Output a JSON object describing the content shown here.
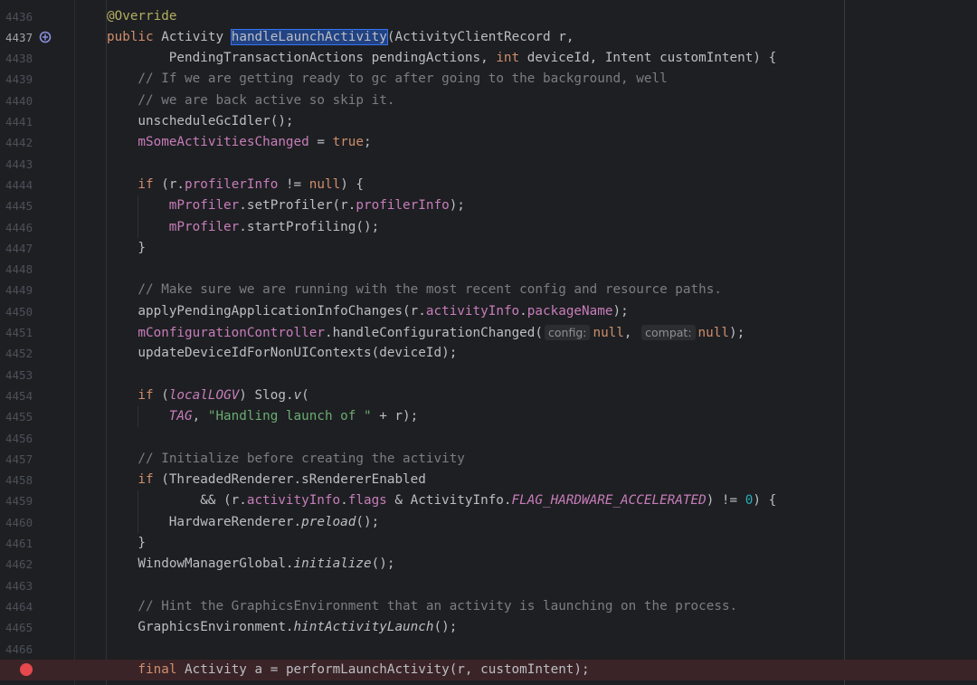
{
  "editor": {
    "lines": [
      {
        "n": "4436",
        "indent": 0,
        "tokens": [
          {
            "t": "@Override",
            "c": "ann"
          }
        ]
      },
      {
        "n": "4437",
        "indent": 0,
        "current": true,
        "icon": "override",
        "tokens": [
          {
            "t": "public ",
            "c": "kw"
          },
          {
            "t": "Activity ",
            "c": ""
          },
          {
            "t": "handleLaunchActivity",
            "c": "sel"
          },
          {
            "t": "(ActivityClientRecord r,",
            "c": ""
          }
        ]
      },
      {
        "n": "4438",
        "indent": 8,
        "tokens": [
          {
            "t": "PendingTransactionActions pendingActions, ",
            "c": ""
          },
          {
            "t": "int",
            "c": "kw"
          },
          {
            "t": " deviceId, Intent customIntent) {",
            "c": ""
          }
        ]
      },
      {
        "n": "4439",
        "indent": 4,
        "tokens": [
          {
            "t": "// If we are getting ready to gc after going to the background, well",
            "c": "cmt"
          }
        ]
      },
      {
        "n": "4440",
        "indent": 4,
        "tokens": [
          {
            "t": "// we are back active so skip it.",
            "c": "cmt"
          }
        ]
      },
      {
        "n": "4441",
        "indent": 4,
        "tokens": [
          {
            "t": "unscheduleGcIdler();",
            "c": ""
          }
        ]
      },
      {
        "n": "4442",
        "indent": 4,
        "tokens": [
          {
            "t": "mSomeActivitiesChanged",
            "c": "fld"
          },
          {
            "t": " = ",
            "c": ""
          },
          {
            "t": "true",
            "c": "kw"
          },
          {
            "t": ";",
            "c": ""
          }
        ]
      },
      {
        "n": "4443",
        "indent": 0,
        "tokens": []
      },
      {
        "n": "4444",
        "indent": 4,
        "tokens": [
          {
            "t": "if",
            "c": "kw"
          },
          {
            "t": " (r.",
            "c": ""
          },
          {
            "t": "profilerInfo",
            "c": "fld"
          },
          {
            "t": " != ",
            "c": ""
          },
          {
            "t": "null",
            "c": "kw"
          },
          {
            "t": ") {",
            "c": ""
          }
        ]
      },
      {
        "n": "4445",
        "indent": 8,
        "tokens": [
          {
            "t": "mProfiler",
            "c": "fld"
          },
          {
            "t": ".setProfiler(r.",
            "c": ""
          },
          {
            "t": "profilerInfo",
            "c": "fld"
          },
          {
            "t": ");",
            "c": ""
          }
        ]
      },
      {
        "n": "4446",
        "indent": 8,
        "tokens": [
          {
            "t": "mProfiler",
            "c": "fld"
          },
          {
            "t": ".startProfiling();",
            "c": ""
          }
        ]
      },
      {
        "n": "4447",
        "indent": 4,
        "tokens": [
          {
            "t": "}",
            "c": ""
          }
        ]
      },
      {
        "n": "4448",
        "indent": 0,
        "tokens": []
      },
      {
        "n": "4449",
        "indent": 4,
        "tokens": [
          {
            "t": "// Make sure we are running with the most recent config and resource paths.",
            "c": "cmt"
          }
        ]
      },
      {
        "n": "4450",
        "indent": 4,
        "tokens": [
          {
            "t": "applyPendingApplicationInfoChanges(r.",
            "c": ""
          },
          {
            "t": "activityInfo",
            "c": "fld"
          },
          {
            "t": ".",
            "c": ""
          },
          {
            "t": "packageName",
            "c": "fld"
          },
          {
            "t": ");",
            "c": ""
          }
        ]
      },
      {
        "n": "4451",
        "indent": 4,
        "tokens": [
          {
            "t": "mConfigurationController",
            "c": "fld"
          },
          {
            "t": ".handleConfigurationChanged(",
            "c": ""
          },
          {
            "t": "config:",
            "c": "hint"
          },
          {
            "t": "null",
            "c": "kw"
          },
          {
            "t": ", ",
            "c": ""
          },
          {
            "t": "compat:",
            "c": "hint"
          },
          {
            "t": "null",
            "c": "kw"
          },
          {
            "t": ");",
            "c": ""
          }
        ]
      },
      {
        "n": "4452",
        "indent": 4,
        "tokens": [
          {
            "t": "updateDeviceIdForNonUIContexts(deviceId);",
            "c": ""
          }
        ]
      },
      {
        "n": "4453",
        "indent": 0,
        "tokens": []
      },
      {
        "n": "4454",
        "indent": 4,
        "tokens": [
          {
            "t": "if",
            "c": "kw"
          },
          {
            "t": " (",
            "c": ""
          },
          {
            "t": "localLOGV",
            "c": "static"
          },
          {
            "t": ") Slog.",
            "c": ""
          },
          {
            "t": "v",
            "c": "it"
          },
          {
            "t": "(",
            "c": ""
          }
        ]
      },
      {
        "n": "4455",
        "indent": 8,
        "tokens": [
          {
            "t": "TAG",
            "c": "static"
          },
          {
            "t": ", ",
            "c": ""
          },
          {
            "t": "\"Handling launch of \"",
            "c": "str"
          },
          {
            "t": " + r);",
            "c": ""
          }
        ]
      },
      {
        "n": "4456",
        "indent": 0,
        "tokens": []
      },
      {
        "n": "4457",
        "indent": 4,
        "tokens": [
          {
            "t": "// Initialize before creating the activity",
            "c": "cmt"
          }
        ]
      },
      {
        "n": "4458",
        "indent": 4,
        "tokens": [
          {
            "t": "if",
            "c": "kw"
          },
          {
            "t": " (ThreadedRenderer.",
            "c": ""
          },
          {
            "t": "sRendererEnabled",
            "c": "fldplain"
          }
        ]
      },
      {
        "n": "4459",
        "indent": 12,
        "tokens": [
          {
            "t": "&& (r.",
            "c": ""
          },
          {
            "t": "activityInfo",
            "c": "fld"
          },
          {
            "t": ".",
            "c": ""
          },
          {
            "t": "flags",
            "c": "fld"
          },
          {
            "t": " & ActivityInfo.",
            "c": ""
          },
          {
            "t": "FLAG_HARDWARE_ACCELERATED",
            "c": "static"
          },
          {
            "t": ") != ",
            "c": ""
          },
          {
            "t": "0",
            "c": "num"
          },
          {
            "t": ") {",
            "c": ""
          }
        ]
      },
      {
        "n": "4460",
        "indent": 8,
        "tokens": [
          {
            "t": "HardwareRenderer.",
            "c": ""
          },
          {
            "t": "preload",
            "c": "it"
          },
          {
            "t": "();",
            "c": ""
          }
        ]
      },
      {
        "n": "4461",
        "indent": 4,
        "tokens": [
          {
            "t": "}",
            "c": ""
          }
        ]
      },
      {
        "n": "4462",
        "indent": 4,
        "tokens": [
          {
            "t": "WindowManagerGlobal.",
            "c": ""
          },
          {
            "t": "initialize",
            "c": "it"
          },
          {
            "t": "();",
            "c": ""
          }
        ]
      },
      {
        "n": "4463",
        "indent": 0,
        "tokens": []
      },
      {
        "n": "4464",
        "indent": 4,
        "tokens": [
          {
            "t": "// Hint the GraphicsEnvironment that an activity is launching on the process.",
            "c": "cmt"
          }
        ]
      },
      {
        "n": "4465",
        "indent": 4,
        "tokens": [
          {
            "t": "GraphicsEnvironment.",
            "c": ""
          },
          {
            "t": "hintActivityLaunch",
            "c": "it"
          },
          {
            "t": "();",
            "c": ""
          }
        ]
      },
      {
        "n": "4466",
        "indent": 0,
        "tokens": []
      },
      {
        "n": "",
        "indent": 4,
        "breakpoint": true,
        "tokens": [
          {
            "t": "final",
            "c": "kw"
          },
          {
            "t": " Activity a = performLaunchActivity(r, customIntent);",
            "c": ""
          }
        ]
      }
    ]
  },
  "colors": {
    "background": "#1e1f22",
    "keyword": "#cf8e6d",
    "annotation": "#b3ae60",
    "comment": "#7a7e85",
    "field": "#c77dbb",
    "string": "#6aab73",
    "number": "#2aacb8",
    "selection": "#214283",
    "breakpoint": "#e5484d"
  },
  "icons": {
    "override": "override-method-icon",
    "breakpoint": "breakpoint-icon"
  }
}
